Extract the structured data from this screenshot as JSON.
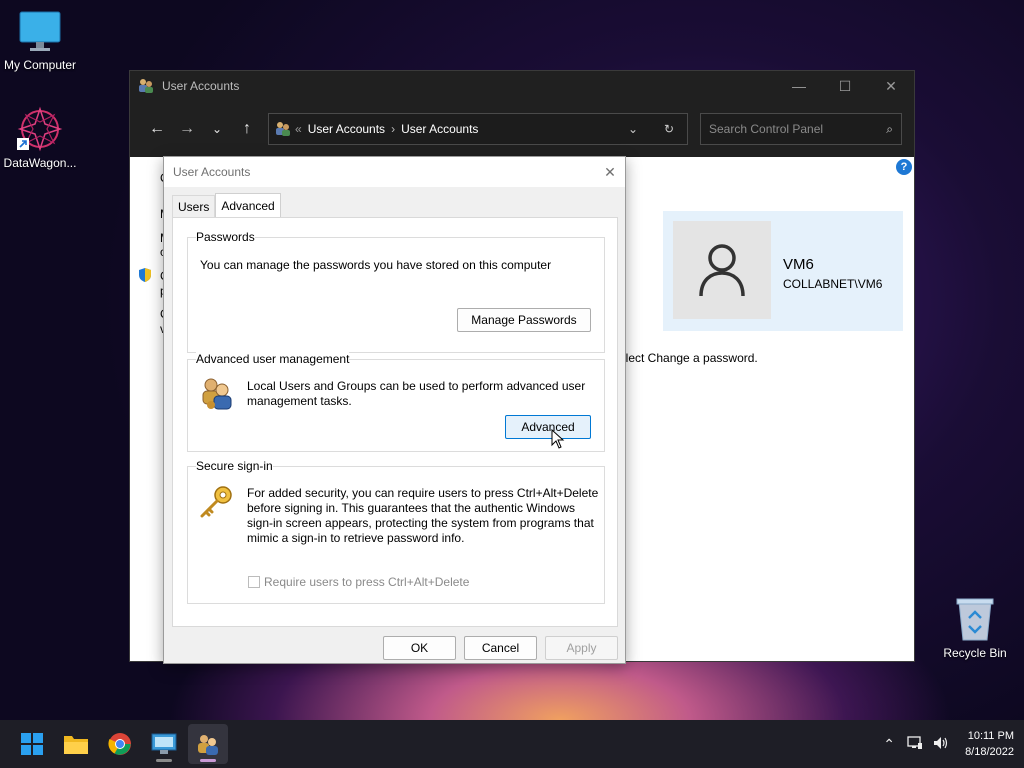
{
  "desktop": {
    "icons": [
      {
        "label": "My Computer"
      },
      {
        "label": "DataWagon..."
      }
    ],
    "recycle_bin": {
      "label": "Recycle Bin"
    }
  },
  "cp_window": {
    "title": "User Accounts",
    "address": {
      "back_chevrons": "«",
      "crumbs": [
        "User Accounts",
        "User Accounts"
      ],
      "separator": "›"
    },
    "search_placeholder": "Search Control Panel",
    "help_label": "?",
    "user": {
      "name": "VM6",
      "domain": "COLLABNET\\VM6"
    },
    "change_password_text": "elect Change a password.",
    "clipped_letters": [
      "C",
      "M",
      "M",
      "c",
      "C",
      "p",
      "C",
      "v"
    ]
  },
  "dialog": {
    "title": "User Accounts",
    "close_label": "✕",
    "tabs": [
      {
        "label": "Users"
      },
      {
        "label": "Advanced"
      }
    ],
    "passwords": {
      "title": "Passwords",
      "text": "You can manage the passwords you have stored on this computer",
      "button": "Manage Passwords"
    },
    "advanced_user_mgmt": {
      "title": "Advanced user management",
      "text": "Local Users and Groups can be used to perform advanced user management tasks.",
      "button": "Advanced"
    },
    "secure_signin": {
      "title": "Secure sign-in",
      "text": "For added security, you can require users to press Ctrl+Alt+Delete before signing in. This guarantees that the authentic Windows sign-in screen appears, protecting the system from programs that mimic a sign-in to retrieve password info.",
      "checkbox_label": "Require users to press Ctrl+Alt+Delete"
    },
    "buttons": {
      "ok": "OK",
      "cancel": "Cancel",
      "apply": "Apply"
    }
  },
  "taskbar": {
    "time": "10:11 PM",
    "date": "8/18/2022"
  },
  "colors": {
    "accent": "#0078d4",
    "titlebar_dark": "#202020",
    "user_card_bg": "#e5f1fb",
    "taskbar_bg": "#1e1e26"
  }
}
